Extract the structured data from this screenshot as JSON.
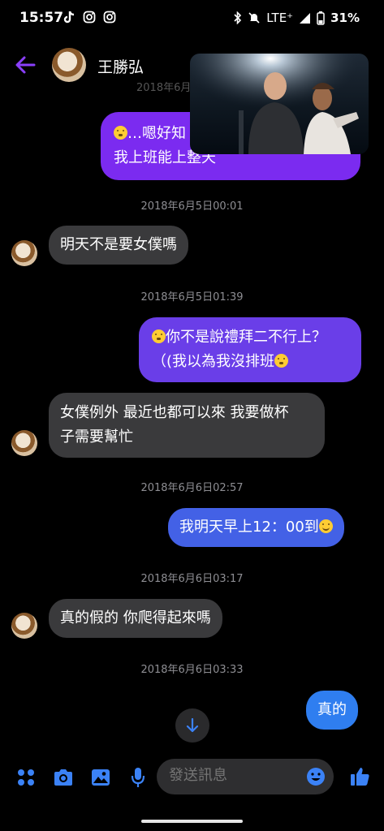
{
  "status_bar": {
    "time": "15:57",
    "network": "LTE⁺",
    "battery": "31%"
  },
  "header": {
    "contact_name": "王勝弘",
    "faded_timestamp": "2018年6月"
  },
  "messages": [
    {
      "type": "out",
      "text_a": "…嗯好知",
      "text_b": "我上班能上整天"
    },
    {
      "type": "timestamp",
      "text": "2018年6月5日00:01"
    },
    {
      "type": "in",
      "text": "明天不是要女僕嗎"
    },
    {
      "type": "timestamp",
      "text": "2018年6月5日01:39"
    },
    {
      "type": "out",
      "text_a": "你不是說禮拜二不行上？",
      "text_b": "（(我以為我沒排班"
    },
    {
      "type": "in",
      "text_a": "女僕例外 最近也都可以來 我要做杯",
      "text_b": "子需要幫忙"
    },
    {
      "type": "timestamp",
      "text": "2018年6月6日02:57"
    },
    {
      "type": "out",
      "text": "我明天早上12：00到"
    },
    {
      "type": "timestamp",
      "text": "2018年6月6日03:17"
    },
    {
      "type": "in",
      "text": "真的假的 你爬得起來嗎"
    },
    {
      "type": "timestamp",
      "text": "2018年6月6日03:33"
    },
    {
      "type": "out",
      "text": "真的"
    }
  ],
  "composer": {
    "placeholder": "發送訊息"
  },
  "colors": {
    "bubble_out_purple": "#7b2bf0",
    "bubble_out_violet": "#6a3ee8",
    "bubble_out_blue": "#4361e6",
    "bubble_out_lightblue": "#2f7ef0",
    "bubble_in": "#3a3a3c",
    "accent": "#8a3ffc"
  },
  "icons": [
    "back-arrow-icon",
    "apps-icon",
    "camera-icon",
    "gallery-icon",
    "microphone-icon",
    "emoji-icon",
    "thumbs-up-icon",
    "scroll-down-icon"
  ]
}
